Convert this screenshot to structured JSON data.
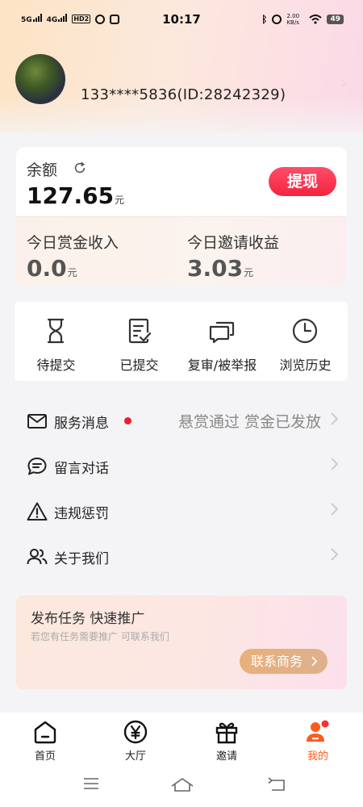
{
  "status_bar": {
    "time": "10:17",
    "left_indicators": [
      "5G",
      "4G",
      "HD2"
    ],
    "speed": "2.00 KB/s",
    "battery": "49"
  },
  "profile": {
    "user_id": "133****5836(ID:28242329)"
  },
  "balance": {
    "label": "余额",
    "value": "127.65",
    "unit": "元",
    "withdraw_label": "提现",
    "today_bounty_label": "今日赏金收入",
    "today_bounty_value": "0.0",
    "today_bounty_unit": "元",
    "today_invite_label": "今日邀请收益",
    "today_invite_value": "3.03",
    "today_invite_unit": "元"
  },
  "actions": [
    {
      "label": "待提交",
      "icon": "hourglass-icon"
    },
    {
      "label": "已提交",
      "icon": "document-check-icon"
    },
    {
      "label": "复审/被举报",
      "icon": "chat-bubbles-icon"
    },
    {
      "label": "浏览历史",
      "icon": "clock-icon"
    }
  ],
  "menu": [
    {
      "label": "服务消息",
      "icon": "mail-icon",
      "subtitle": "悬赏通过 赏金已发放",
      "has_dot": true
    },
    {
      "label": "留言对话",
      "icon": "chat-icon"
    },
    {
      "label": "违规惩罚",
      "icon": "warning-icon"
    },
    {
      "label": "关于我们",
      "icon": "users-icon"
    }
  ],
  "promo": {
    "title": "发布任务 快速推广",
    "subtitle": "若您有任务需要推广 可联系我们",
    "button_label": "联系商务"
  },
  "tabs": [
    {
      "label": "首页",
      "icon": "home-icon"
    },
    {
      "label": "大厅",
      "icon": "yen-icon"
    },
    {
      "label": "邀请",
      "icon": "gift-icon"
    },
    {
      "label": "我的",
      "icon": "profile-icon",
      "active": true
    }
  ],
  "colors": {
    "accent_red": "#f4243f",
    "active_tab": "#ff5a1f",
    "promo_button": "#e9b07a"
  }
}
